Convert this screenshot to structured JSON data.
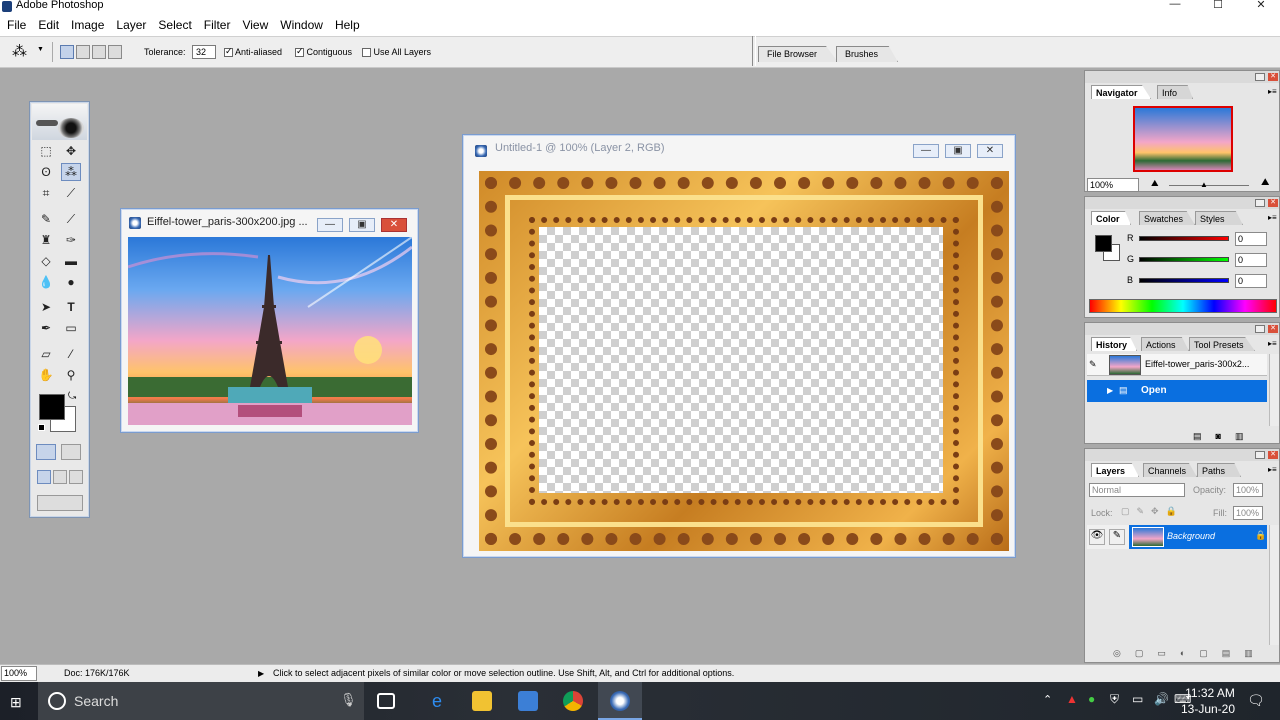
{
  "app": {
    "title": "Adobe Photoshop"
  },
  "window_controls": {
    "minimize": "—",
    "maximize": "☐",
    "close": "✕"
  },
  "menu": [
    "File",
    "Edit",
    "Image",
    "Layer",
    "Select",
    "Filter",
    "View",
    "Window",
    "Help"
  ],
  "options_bar": {
    "tolerance_label": "Tolerance:",
    "tolerance_value": "32",
    "anti_aliased": {
      "label": "Anti-aliased",
      "checked": true
    },
    "contiguous": {
      "label": "Contiguous",
      "checked": true
    },
    "use_all_layers": {
      "label": "Use All Layers",
      "checked": false
    },
    "palette_well_tabs": [
      "File Browser",
      "Brushes"
    ]
  },
  "documents": {
    "eiffel": {
      "title": "Eiffel-tower_paris-300x200.jpg ..."
    },
    "untitled": {
      "title": "Untitled-1 @ 100% (Layer 2, RGB)"
    }
  },
  "navigator": {
    "tabs": [
      "Navigator",
      "Info"
    ],
    "zoom": "100%"
  },
  "color": {
    "tabs": [
      "Color",
      "Swatches",
      "Styles"
    ],
    "r_label": "R",
    "g_label": "G",
    "b_label": "B",
    "r": "0",
    "g": "0",
    "b": "0"
  },
  "history": {
    "tabs": [
      "History",
      "Actions",
      "Tool Presets"
    ],
    "snapshot": "Eiffel-tower_paris-300x2...",
    "states": [
      "Open"
    ]
  },
  "layers": {
    "tabs": [
      "Layers",
      "Channels",
      "Paths"
    ],
    "blend_mode": "Normal",
    "opacity_label": "Opacity:",
    "opacity": "100%",
    "lock_label": "Lock:",
    "fill_label": "Fill:",
    "fill": "100%",
    "items": [
      {
        "name": "Background",
        "selected": true
      }
    ]
  },
  "status": {
    "zoom": "100%",
    "doc": "Doc: 176K/176K",
    "hint": "Click to select adjacent pixels of similar color or move selection outline.  Use Shift, Alt, and Ctrl for additional options."
  },
  "taskbar": {
    "search_placeholder": "Search",
    "time": "11:32 AM",
    "date": "13-Jun-20"
  },
  "colors": {
    "selection_blue": "#0a6fe0",
    "menu_bg": "#ffffff",
    "workspace": "#a9a9a9",
    "taskbar": "#1f252c"
  }
}
